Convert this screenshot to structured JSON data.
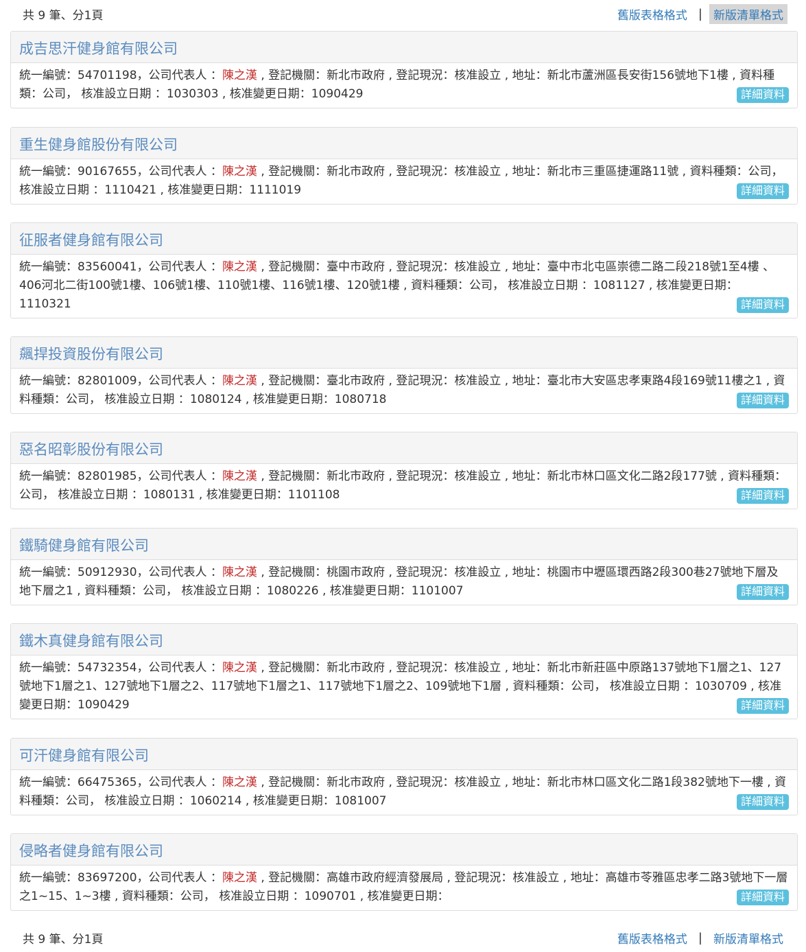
{
  "pager": {
    "count_text": "共 9 筆、分1頁",
    "old_format": "舊版表格格式",
    "separator": "|",
    "new_format": "新版清單格式"
  },
  "labels": {
    "tax_id": "統一編號：",
    "rep": "公司代表人 ：",
    "authority": "登記機關：",
    "status": "登記現況：",
    "address": "地址：",
    "data_type": "資料種類：",
    "approve_date": "核准設立日期 ：",
    "change_date": "核准變更日期：",
    "detail_button": "詳細資料"
  },
  "companies": [
    {
      "name": "成吉思汗健身館有限公司",
      "tax_id": "54701198",
      "rep": "陳之漢",
      "authority": "新北市政府",
      "status": "核准設立",
      "address": "新北市蘆洲區長安街156號地下1樓",
      "data_type": "公司",
      "approve_date": "1030303",
      "change_date": "1090429"
    },
    {
      "name": "重生健身館股份有限公司",
      "tax_id": "90167655",
      "rep": "陳之漢",
      "authority": "新北市政府",
      "status": "核准設立",
      "address": "新北市三重區捷運路11號",
      "data_type": "公司",
      "approve_date": "1110421",
      "change_date": "1111019"
    },
    {
      "name": "征服者健身館有限公司",
      "tax_id": "83560041",
      "rep": "陳之漢",
      "authority": "臺中市政府",
      "status": "核准設立",
      "address": "臺中市北屯區崇德二路二段218號1至4樓 、406河北二街100號1樓、106號1樓、110號1樓、116號1樓、120號1樓",
      "data_type": "公司",
      "approve_date": "1081127",
      "change_date": "1110321"
    },
    {
      "name": "飆捍投資股份有限公司",
      "tax_id": "82801009",
      "rep": "陳之漢",
      "authority": "臺北市政府",
      "status": "核准設立",
      "address": "臺北市大安區忠孝東路4段169號11樓之1",
      "data_type": "公司",
      "approve_date": "1080124",
      "change_date": "1080718"
    },
    {
      "name": "惡名昭彰股份有限公司",
      "tax_id": "82801985",
      "rep": "陳之漢",
      "authority": "新北市政府",
      "status": "核准設立",
      "address": "新北市林口區文化二路2段177號",
      "data_type": "公司",
      "approve_date": "1080131",
      "change_date": "1101108"
    },
    {
      "name": "鐵騎健身館有限公司",
      "tax_id": "50912930",
      "rep": "陳之漢",
      "authority": "桃園市政府",
      "status": "核准設立",
      "address": "桃園市中壢區環西路2段300巷27號地下層及地下層之1",
      "data_type": "公司",
      "approve_date": "1080226",
      "change_date": "1101007"
    },
    {
      "name": "鐵木真健身館有限公司",
      "tax_id": "54732354",
      "rep": "陳之漢",
      "authority": "新北市政府",
      "status": "核准設立",
      "address": "新北市新莊區中原路137號地下1層之1、127號地下1層之1、127號地下1層之2、117號地下1層之1、117號地下1層之2、109號地下1層",
      "data_type": "公司",
      "approve_date": "1030709",
      "change_date": "1090429"
    },
    {
      "name": "可汗健身館有限公司",
      "tax_id": "66475365",
      "rep": "陳之漢",
      "authority": "新北市政府",
      "status": "核准設立",
      "address": "新北市林口區文化二路1段382號地下一樓",
      "data_type": "公司",
      "approve_date": "1060214",
      "change_date": "1081007"
    },
    {
      "name": "侵略者健身館有限公司",
      "tax_id": "83697200",
      "rep": "陳之漢",
      "authority": "高雄市政府經濟發展局",
      "status": "核准設立",
      "address": "高雄市苓雅區忠孝二路3號地下一層之1~15、1~3樓",
      "data_type": "公司",
      "approve_date": "1090701",
      "change_date": ""
    }
  ]
}
